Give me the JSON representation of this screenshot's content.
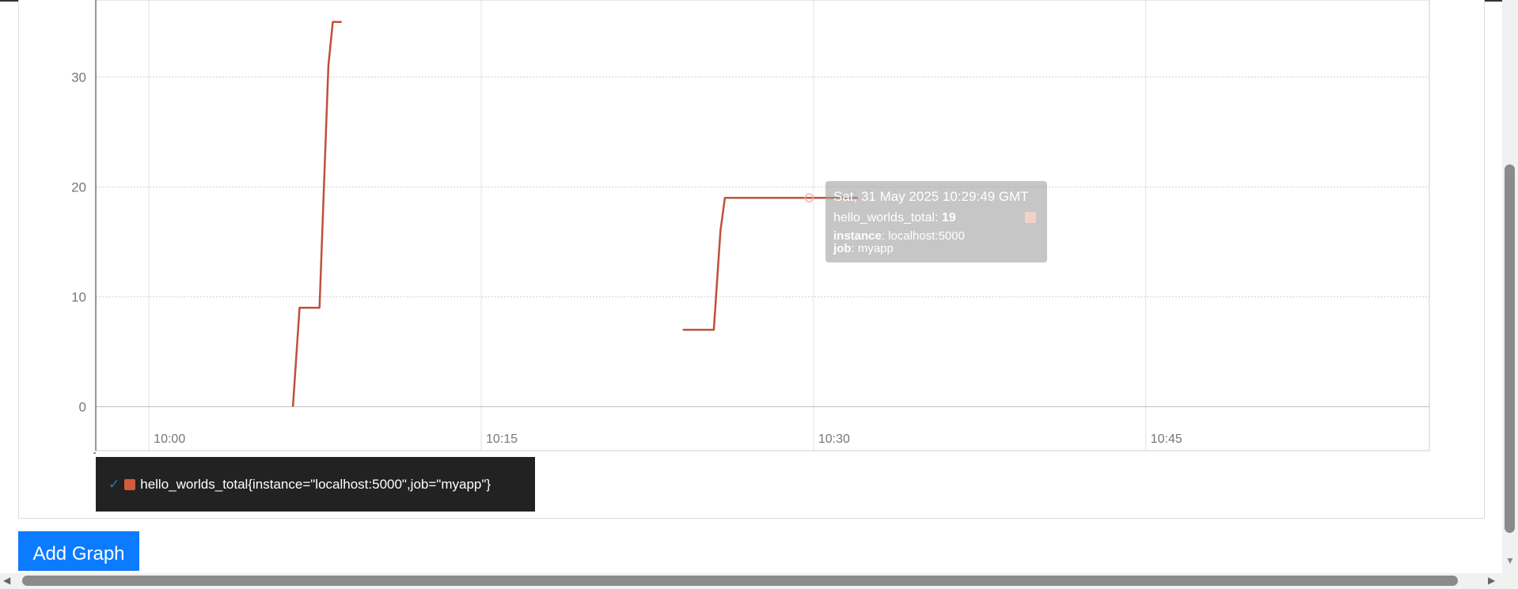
{
  "chart_data": {
    "type": "line",
    "y_ticks": [
      "0",
      "10",
      "20",
      "30"
    ],
    "x_ticks": [
      "10:00",
      "10:15",
      "10:30",
      "10:45"
    ],
    "ylim": [
      -4,
      37
    ],
    "xlim_minutes": [
      "09:57.6",
      "10:57.8"
    ],
    "grid": true,
    "series": [
      {
        "name": "hello_worlds_total{instance=\"localhost:5000\",job=\"myapp\"}",
        "color": "#c0503a",
        "segments": [
          [
            [
              "10:06.5",
              0
            ],
            [
              "10:06.8",
              9
            ],
            [
              "10:07.7",
              9
            ],
            [
              "10:07.9",
              20
            ],
            [
              "10:08.1",
              31
            ],
            [
              "10:08.3",
              35
            ],
            [
              "10:08.7",
              35
            ]
          ],
          [
            [
              "10:24.1",
              7
            ],
            [
              "10:25.5",
              7
            ],
            [
              "10:25.8",
              16
            ],
            [
              "10:26.0",
              19
            ],
            [
              "10:29.8",
              19
            ],
            [
              "10:32.0",
              19
            ]
          ]
        ]
      }
    ]
  },
  "tooltip": {
    "date": "Sat, 31 May 2025 10:29:49 GMT",
    "metric": "hello_worlds_total",
    "value": "19",
    "labels": [
      {
        "key": "instance",
        "value": "localhost:5000"
      },
      {
        "key": "job",
        "value": "myapp"
      }
    ]
  },
  "legend": {
    "check": "✓",
    "text": "hello_worlds_total{instance=\"localhost:5000\",job=\"myapp\"}"
  },
  "add_graph_label": "Add Graph"
}
